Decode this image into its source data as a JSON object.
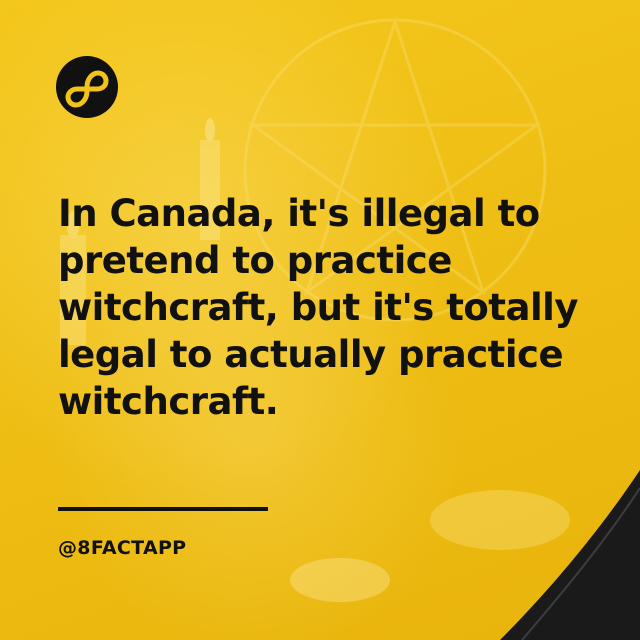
{
  "brand": {
    "logo_icon": "infinity-eight-icon",
    "handle": "@8FACTAPP",
    "accent_color": "#f2c318",
    "text_color": "#111111"
  },
  "fact": {
    "lines": [
      "In Canada, it's illegal to",
      "pretend to practice",
      "witchcraft, but it's totally",
      "legal to actually practice",
      "witchcraft."
    ]
  }
}
